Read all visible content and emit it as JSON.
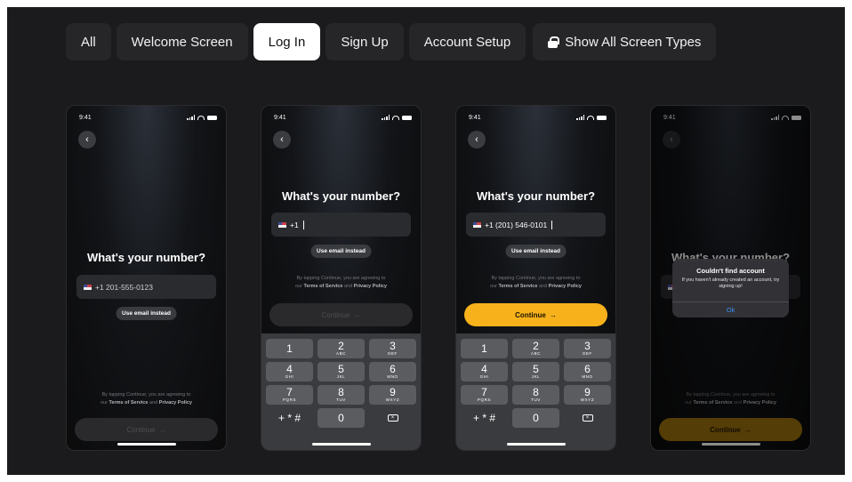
{
  "tabs": [
    "All",
    "Welcome Screen",
    "Log In",
    "Sign Up",
    "Account Setup",
    "Show All Screen Types"
  ],
  "active_tab": "Log In",
  "colors": {
    "accent": "#f7b21b",
    "background": "#1b1b1d",
    "alert_button": "#3e8df2"
  },
  "status_time": "9:41",
  "title": "What's your number?",
  "email_button": "Use email instead",
  "terms": {
    "line1": "By tapping Continue, you are agreeing to",
    "prefix": "our",
    "tos": "Terms of Service",
    "and": "and",
    "privacy": "Privacy Policy"
  },
  "continue_label": "Continue",
  "arrow": "→",
  "back_glyph": "‹",
  "screens": [
    {
      "field_value": "+1 201-555-0123"
    },
    {
      "field_value": "+1"
    },
    {
      "field_value": "+1 (201) 546-0101"
    },
    {
      "field_value": ""
    }
  ],
  "keypad": [
    {
      "digit": "1",
      "letters": ""
    },
    {
      "digit": "2",
      "letters": "ABC"
    },
    {
      "digit": "3",
      "letters": "DEF"
    },
    {
      "digit": "4",
      "letters": "GHI"
    },
    {
      "digit": "5",
      "letters": "JKL"
    },
    {
      "digit": "6",
      "letters": "MNO"
    },
    {
      "digit": "7",
      "letters": "PQRS"
    },
    {
      "digit": "8",
      "letters": "TUV"
    },
    {
      "digit": "9",
      "letters": "WXYZ"
    },
    {
      "digit": "+ * #",
      "letters": ""
    },
    {
      "digit": "0",
      "letters": ""
    },
    {
      "digit": "⌫",
      "letters": ""
    }
  ],
  "alert": {
    "title": "Couldn't find account",
    "message": "If you haven't already created an account, try signing up!",
    "button": "Ok"
  }
}
